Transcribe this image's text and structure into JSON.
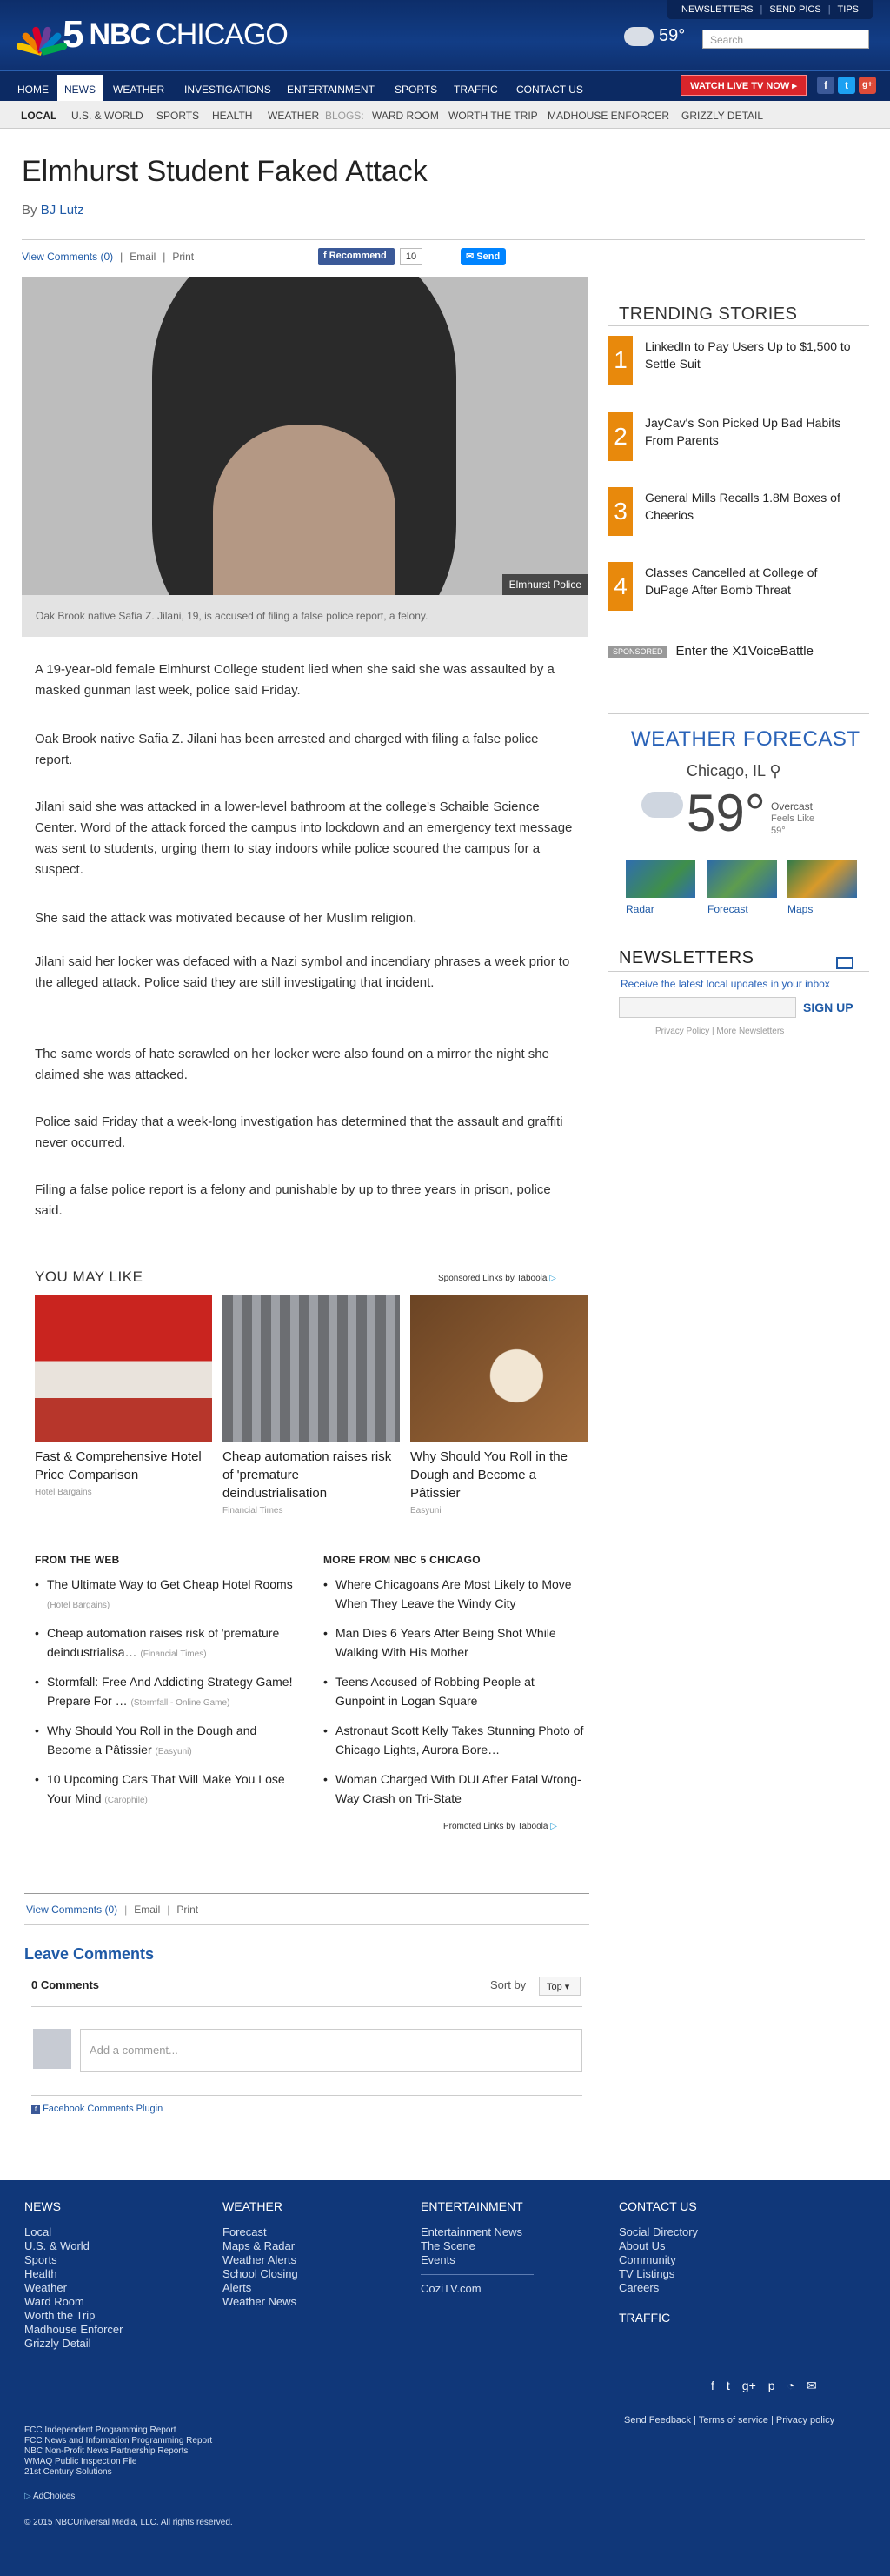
{
  "header": {
    "toplinks": [
      "NEWSLETTERS",
      "SEND PICS",
      "TIPS"
    ],
    "logo_number": "5",
    "logo_nbc": "NBC",
    "logo_city": "CHICAGO",
    "temperature": "59°",
    "search_placeholder": "Search"
  },
  "nav": {
    "items": [
      "HOME",
      "NEWS",
      "WEATHER",
      "INVESTIGATIONS",
      "ENTERTAINMENT",
      "SPORTS",
      "TRAFFIC",
      "CONTACT US"
    ],
    "live_button": "WATCH LIVE TV NOW ▸",
    "social": [
      "f",
      "t",
      "g+"
    ]
  },
  "subnav": {
    "items": [
      "LOCAL",
      "U.S. & WORLD",
      "SPORTS",
      "HEALTH",
      "WEATHER",
      "BLOGS:",
      "WARD ROOM",
      "WORTH THE TRIP",
      "MADHOUSE ENFORCER",
      "GRIZZLY DETAIL"
    ]
  },
  "article": {
    "headline": "Elmhurst Student Faked Attack",
    "byline_prefix": "By",
    "author": "BJ Lutz",
    "tools": [
      "View Comments (0)",
      "|",
      "Email",
      "|",
      "Print"
    ],
    "recommend_label": "Recommend",
    "recommend_count": "10",
    "send_label": "Send",
    "photo_credit": "Elmhurst Police",
    "caption": "Oak Brook native Safia Z. Jilani, 19, is accused of filing a false police report, a felony.",
    "paragraphs": [
      "A 19-year-old female Elmhurst College student lied when she said she was assaulted by a masked gunman last week, police said Friday.",
      "Oak Brook native Safia Z. Jilani has been arrested and charged with filing a false police report.",
      "Jilani said she was attacked in a lower-level bathroom at the college's Schaible Science Center. Word of the attack forced the campus into lockdown and an emergency text message was sent to students, urging them to stay indoors while police scoured the campus for a suspect.",
      "She said the attack was motivated because of her Muslim religion.",
      "Jilani said her locker was defaced with a Nazi symbol and incendiary phrases a week prior to the alleged attack. Police said they are still investigating that incident.",
      "The same words of hate scrawled on her locker were also found on a mirror the night she claimed she was attacked.",
      "Police said Friday that a week-long investigation has determined that the assault and graffiti never occurred.",
      "Filing a false police report is a felony and punishable by up to three years in prison, police said."
    ]
  },
  "trending": {
    "heading": "TRENDING STORIES",
    "items": [
      {
        "num": "1",
        "title": "LinkedIn to Pay Users Up to $1,500 to Settle Suit"
      },
      {
        "num": "2",
        "title": "JayCav's Son Picked Up Bad Habits From Parents"
      },
      {
        "num": "3",
        "title": "General Mills Recalls 1.8M Boxes of Cheerios"
      },
      {
        "num": "4",
        "title": "Classes Cancelled at College of DuPage After Bomb Threat"
      }
    ],
    "sponsored_tag": "SPONSORED",
    "sponsored_text": "Enter the X1VoiceBattle"
  },
  "weather": {
    "heading": "WEATHER FORECAST",
    "city": "Chicago, IL",
    "temp": "59°",
    "condition": "Overcast",
    "feels_like_label": "Feels Like",
    "feels_like": "59°",
    "maps": [
      "Radar",
      "Forecast",
      "Maps"
    ]
  },
  "newsletters": {
    "heading": "NEWSLETTERS",
    "subtitle": "Receive the latest local updates in your inbox",
    "signup": "SIGN UP",
    "links": "Privacy Policy | More Newsletters"
  },
  "you_may_like": {
    "heading": "YOU MAY LIKE",
    "taboola": "Sponsored Links  by Taboola",
    "cards": [
      {
        "title": "Fast & Comprehensive Hotel Price Comparison",
        "source": "Hotel Bargains"
      },
      {
        "title": "Cheap automation raises risk of 'premature deindustrialisation",
        "source": "Financial Times"
      },
      {
        "title": "Why Should You Roll in the Dough and Become a Pâtissier",
        "source": "Easyuni"
      }
    ]
  },
  "from_web": {
    "heading": "FROM THE WEB",
    "items": [
      {
        "title": "The Ultimate Way to Get Cheap Hotel Rooms",
        "source": "(Hotel Bargains)"
      },
      {
        "title": "Cheap automation raises risk of 'premature deindustrialisa…",
        "source": "(Financial Times)"
      },
      {
        "title": "Stormfall: Free And Addicting Strategy Game! Prepare For …",
        "source": "(Stormfall - Online Game)"
      },
      {
        "title": "Why Should You Roll in the Dough and Become a Pâtissier",
        "source": "(Easyuni)"
      },
      {
        "title": "10 Upcoming Cars That Will Make You Lose Your Mind",
        "source": "(Carophile)"
      }
    ]
  },
  "more_nbc": {
    "heading": "MORE FROM NBC 5 CHICAGO",
    "items": [
      "Where Chicagoans Are Most Likely to Move When They Leave the Windy City",
      "Man Dies 6 Years After Being Shot While Walking With His Mother",
      "Teens Accused of Robbing People at Gunpoint in Logan Square",
      "Astronaut Scott Kelly Takes Stunning Photo of Chicago Lights, Aurora Bore…",
      "Woman Charged With DUI After Fatal Wrong-Way Crash on Tri-State"
    ],
    "promoted": "Promoted Links  by Taboola"
  },
  "comments": {
    "tools": [
      "View Comments (0)",
      "|",
      "Email",
      "|",
      "Print"
    ],
    "heading": "Leave Comments",
    "count": "0 Comments",
    "sort_label": "Sort by",
    "sort_value": "Top ▾",
    "placeholder": "Add a comment...",
    "plugin": "Facebook Comments Plugin"
  },
  "footer": {
    "news": {
      "heading": "NEWS",
      "items": [
        "Local",
        "U.S. & World",
        "Sports",
        "Health",
        "Weather",
        "Ward Room",
        "Worth the Trip",
        "Madhouse Enforcer",
        "Grizzly Detail"
      ]
    },
    "weather": {
      "heading": "WEATHER",
      "items": [
        "Forecast",
        "Maps & Radar",
        "Weather Alerts",
        "School Closing",
        "Alerts",
        "Weather News"
      ]
    },
    "entertainment": {
      "heading": "ENTERTAINMENT",
      "items": [
        "Entertainment News",
        "The Scene",
        "Events"
      ],
      "cozi": "CoziTV.com"
    },
    "contact": {
      "heading": "CONTACT US",
      "items": [
        "Social Directory",
        "About Us",
        "Community",
        "TV Listings",
        "Careers"
      ],
      "traffic": "TRAFFIC"
    },
    "links": "Send Feedback   |   Terms of service   |   Privacy policy",
    "fcc": [
      "FCC Independent Programming Report",
      "FCC News and Information Programming Report",
      "NBC Non-Profit News Partnership Reports",
      "WMAQ Public Inspection File",
      "21st Century Solutions"
    ],
    "adchoices": "AdChoices",
    "copyright": "© 2015 NBCUniversal Media, LLC. All rights reserved."
  },
  "colors": {
    "brand_navy": "#103779",
    "accent_orange": "#e8890c",
    "live_red": "#d9252b",
    "link_blue": "#1f5aa6"
  }
}
